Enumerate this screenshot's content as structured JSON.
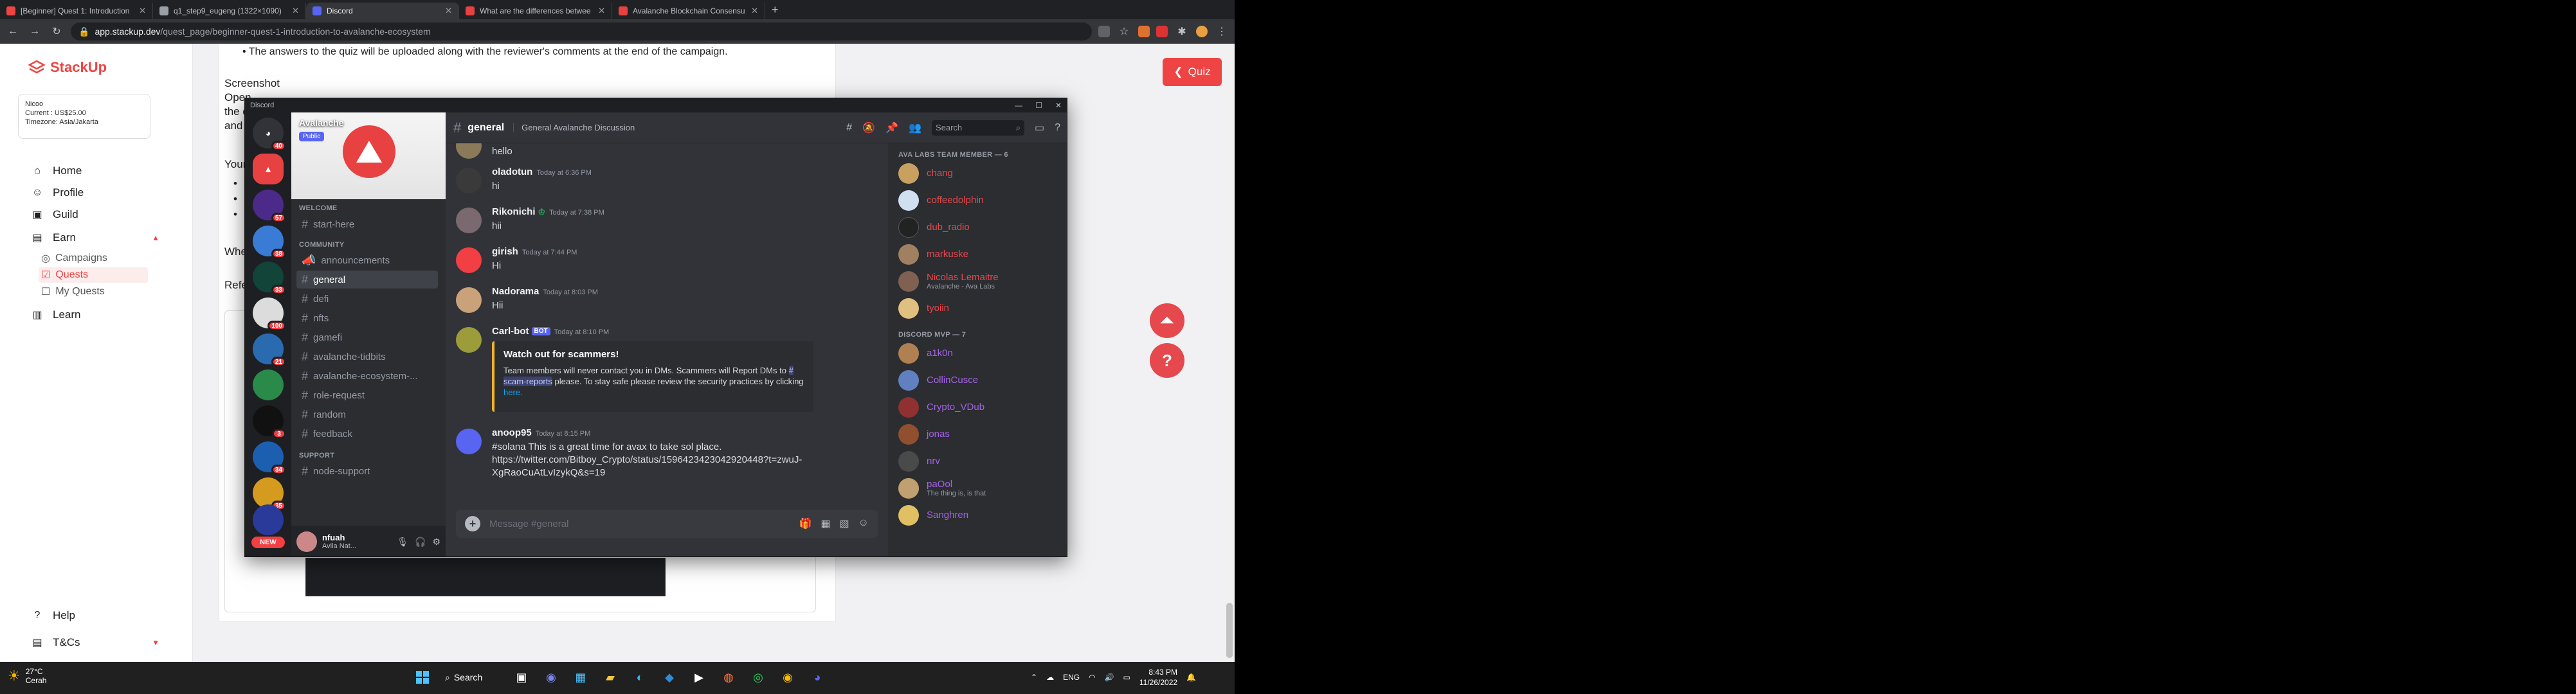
{
  "browser": {
    "tabs": [
      {
        "label": "[Beginner] Quest 1: Introduction",
        "color": "#ef4444",
        "active": false
      },
      {
        "label": "q1_step9_eugeng (1322×1090)",
        "color": "#9aa0a6",
        "active": false
      },
      {
        "label": "Discord",
        "color": "#5865f2",
        "active": true
      },
      {
        "label": "What are the differences betwee",
        "color": "#e84142",
        "active": false
      },
      {
        "label": "Avalanche Blockchain Consensu",
        "color": "#e84142",
        "active": false
      }
    ],
    "url_host": "app.stackup.dev",
    "url_path": "/quest_page/beginner-quest-1-introduction-to-avalanche-ecosystem"
  },
  "stackup": {
    "logo": "StackUp",
    "user": {
      "name": "Nicoo",
      "current": "Current : US$25.00",
      "timezone": "Timezone: Asia/Jakarta"
    },
    "nav": {
      "home": "Home",
      "profile": "Profile",
      "guild": "Guild",
      "earn": "Earn",
      "campaigns": "Campaigns",
      "quests": "Quests",
      "my_quests": "My Quests",
      "learn": "Learn",
      "help": "Help",
      "tcs": "T&Cs"
    },
    "content": {
      "bullet": "The answers to the quiz will be uploaded along with the reviewer's comments at the end of the campaign.",
      "screenshot_heading": "Screenshot",
      "fragment_open": "Open",
      "fragment_the": "the c",
      "fragment_and": "and t",
      "fragment_your": "Your",
      "fragment_when": "When",
      "fragment_ref": "Refe"
    },
    "quiz_button": "Quiz"
  },
  "discord": {
    "window_title": "Discord",
    "server_name": "Avalanche",
    "public_tag": "Public",
    "guild_badges": [
      "40",
      "",
      "57",
      "38",
      "33",
      "100",
      "21",
      "",
      "3",
      "34",
      "35",
      ""
    ],
    "new_label": "NEW",
    "categories": {
      "welcome": "WELCOME",
      "community": "COMMUNITY",
      "support": "SUPPORT"
    },
    "channels": {
      "start_here": "start-here",
      "announcements": "announcements",
      "general": "general",
      "defi": "defi",
      "nfts": "nfts",
      "gamefi": "gamefi",
      "tidbits": "avalanche-tidbits",
      "ecosystem": "avalanche-ecosystem-...",
      "role_request": "role-request",
      "random": "random",
      "feedback": "feedback",
      "node_support": "node-support"
    },
    "user": {
      "name": "nfuah",
      "status": "Avila Nat..."
    },
    "chat_channel": "general",
    "chat_topic": "General Avalanche Discussion",
    "search_placeholder": "Search",
    "messages": [
      {
        "author": "",
        "time": "",
        "text": "hello",
        "color": "#8a7a5a"
      },
      {
        "author": "oladotun",
        "time": "Today at 6:36 PM",
        "text": "hi",
        "color": "#3a3a3a"
      },
      {
        "author": "Rikonichi",
        "time": "Today at 7:38 PM",
        "text": "hii",
        "color": "#7a6a70"
      },
      {
        "author": "girish",
        "time": "Today at 7:44 PM",
        "text": "Hi",
        "color": "#f23f43"
      },
      {
        "author": "Nadorama",
        "time": "Today at 8:03 PM",
        "text": "Hii",
        "color": "#c9a27a"
      },
      {
        "author": "Carl-bot",
        "time": "Today at 8:10 PM",
        "text": "",
        "color": "#9c9c3a"
      },
      {
        "author": "anoop95",
        "time": "Today at 8:15 PM",
        "text": "#solana This is a great time for avax to take sol place.",
        "color": "#5865f2"
      }
    ],
    "bot_tag": "BOT",
    "embed": {
      "title": "Watch out for scammers!",
      "body_a": "Team members will never contact you in DMs. Scammers will Report DMs to ",
      "body_channel": "# scam-reports",
      "body_b": " please. To stay safe please review the security practices by clicking ",
      "body_link": "here."
    },
    "link_1": "https://twitter.com/Bitboy_Crypto/status/1596423423042920448?t=zwuJ-",
    "link_2": "XgRaoCuAtLvIzykQ&s=19",
    "input_placeholder": "Message #general",
    "member_groups": {
      "team": "AVA LABS TEAM MEMBER — 6",
      "mvp": "DISCORD MVP — 7"
    },
    "team_members": [
      {
        "name": "chang",
        "status": "",
        "color": "#e5484d",
        "avatar": "#c8a060"
      },
      {
        "name": "coffeedolphin",
        "status": "",
        "color": "#e5484d",
        "avatar": "#d0e0f0"
      },
      {
        "name": "dub_radio",
        "status": "",
        "color": "#e5484d",
        "avatar": "#222"
      },
      {
        "name": "markuske",
        "status": "",
        "color": "#e5484d",
        "avatar": "#a08060"
      },
      {
        "name": "Nicolas Lemaitre",
        "status": "Avalanche - Ava Labs",
        "color": "#e5484d",
        "avatar": "#806050"
      },
      {
        "name": "tyoiin",
        "status": "",
        "color": "#e5484d",
        "avatar": "#e0c080"
      }
    ],
    "mvp_members": [
      {
        "name": "a1k0n",
        "status": "",
        "color": "#a463e5",
        "avatar": "#b08050"
      },
      {
        "name": "CollinCusce",
        "status": "",
        "color": "#a463e5",
        "avatar": "#6080c0"
      },
      {
        "name": "Crypto_VDub",
        "status": "",
        "color": "#a463e5",
        "avatar": "#903030"
      },
      {
        "name": "jonas",
        "status": "",
        "color": "#a463e5",
        "avatar": "#905030"
      },
      {
        "name": "nrv",
        "status": "",
        "color": "#a463e5",
        "avatar": "#4a4a4a"
      },
      {
        "name": "paOol",
        "status": "The thing is, is that",
        "color": "#a463e5",
        "avatar": "#c0a070"
      },
      {
        "name": "Sanghren",
        "status": "",
        "color": "#a463e5",
        "avatar": "#e0c060"
      }
    ]
  },
  "taskbar": {
    "temp": "27°C",
    "weather": "Cerah",
    "search": "Search",
    "lang": "ENG",
    "time": "8:43 PM",
    "date": "11/26/2022"
  },
  "colors": {
    "brand": "#ef4444",
    "discord_bg": "#313338",
    "blurple": "#5865f2"
  }
}
